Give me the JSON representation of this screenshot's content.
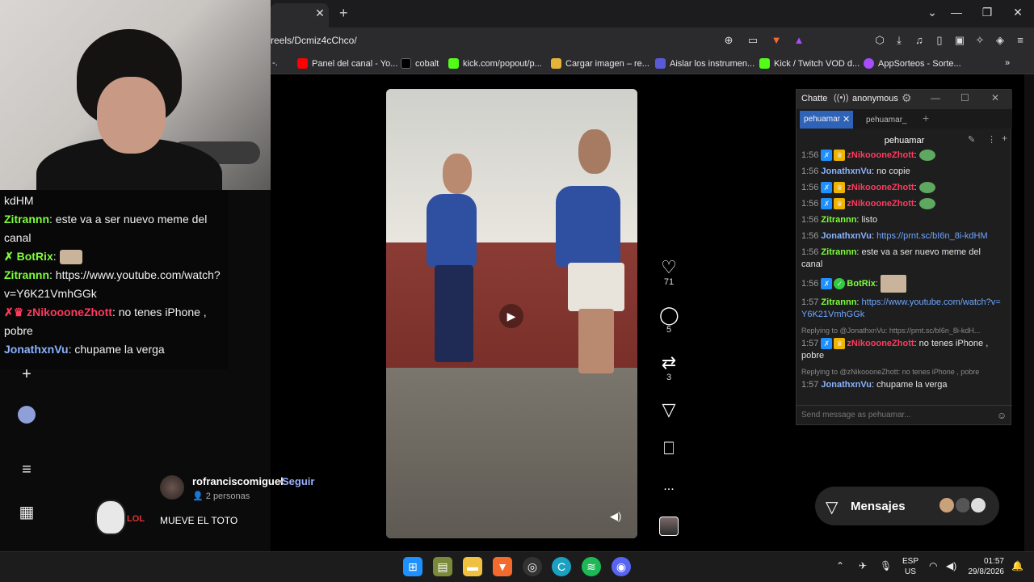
{
  "browser": {
    "tab_close": "✕",
    "new_tab": "+",
    "url": "reels/Dcmiz4cChco/",
    "bookmarks": [
      {
        "label": "-.",
        "color": ""
      },
      {
        "label": "Panel del canal - Yo...",
        "color": "#ff0000"
      },
      {
        "label": "cobalt",
        "color": "#222222"
      },
      {
        "label": "kick.com/popout/p...",
        "color": "#53fc18"
      },
      {
        "label": "Cargar imagen – re...",
        "color": "#e6b33a"
      },
      {
        "label": "Aislar los instrumen...",
        "color": "#5a5ad8"
      },
      {
        "label": "Kick / Twitch VOD d...",
        "color": "#53fc18"
      },
      {
        "label": "AppSorteos - Sorte...",
        "color": "#a64dff"
      }
    ],
    "more_bookmarks": "»",
    "window_controls": [
      "⌄",
      "—",
      "❐",
      "✕"
    ]
  },
  "left_chat": {
    "lines": [
      {
        "user": "",
        "text": "kdHM",
        "color": "#f0f0f0"
      },
      {
        "user": "Zitrannn",
        "text": ": este va a ser nuevo meme del canal",
        "color": "#7fff3a"
      },
      {
        "user": "✗ BotRix",
        "text": ":",
        "color": "#7fff3a"
      },
      {
        "user": "Zitrannn",
        "text": ": https://www.youtube.com/watch?v=Y6K21VmhGGk",
        "color": "#7fff3a"
      },
      {
        "user": "✗♛ zNikoooneZhott",
        "text": ": no tenes iPhone , pobre",
        "color": "#ff3a5e"
      },
      {
        "user": "JonathxnVu",
        "text": ": chupame la verga",
        "color": "#8ab4ff"
      }
    ]
  },
  "sidebar": {
    "icons": [
      "plus-icon",
      "avatar-icon",
      "menu-icon",
      "grid-icon"
    ]
  },
  "reel": {
    "likes": "71",
    "comments": "5",
    "reposts": "3",
    "more": "...",
    "author": "rofranciscomiguel",
    "follow_sep": "•",
    "follow": "Seguir",
    "persons": "2 personas",
    "caption": "MUEVE EL TOTO",
    "meme_text": "LOL"
  },
  "chatterino": {
    "title": "Chatte",
    "anon": "anonymous",
    "tabs": [
      "pehuamar",
      "pehuamar_"
    ],
    "add_tab": "+",
    "channel": "pehuamar",
    "messages": [
      {
        "time": "1:56",
        "user": "zNikoooneZhott",
        "text": "",
        "color": "#ff3a5e",
        "badges": true
      },
      {
        "time": "1:56",
        "user": "JonathxnVu",
        "text": "no copie",
        "color": "#8ab4ff"
      },
      {
        "time": "1:56",
        "user": "zNikoooneZhott",
        "text": "",
        "color": "#ff3a5e",
        "badges": true
      },
      {
        "time": "1:56",
        "user": "zNikoooneZhott",
        "text": "",
        "color": "#ff3a5e",
        "badges": true
      },
      {
        "time": "1:56",
        "user": "Zitrannn",
        "text": "listo",
        "color": "#7fff3a"
      },
      {
        "time": "1:56",
        "user": "JonathxnVu",
        "text": "https://prnt.sc/bI6n_8i-kdHM",
        "color": "#8ab4ff",
        "link": true
      },
      {
        "time": "1:56",
        "user": "Zitrannn",
        "text": "este va a ser nuevo meme del canal",
        "color": "#7fff3a"
      },
      {
        "time": "1:56",
        "user": "BotRix",
        "text": "",
        "color": "#7fff3a",
        "badges": true
      },
      {
        "time": "1:57",
        "user": "Zitrannn",
        "text": "https://www.youtube.com/watch?v=Y6K21VmhGGk",
        "color": "#7fff3a",
        "link": true
      },
      {
        "reply": "Replying to @JonathxnVu: https://prnt.sc/bI6n_8i-kdH...",
        "time": "1:57",
        "user": "zNikoooneZhott",
        "text": "no tenes iPhone , pobre",
        "color": "#ff3a5e",
        "badges": true
      },
      {
        "reply": "Replying to @zNikoooneZhott: no tenes iPhone , pobre",
        "time": "1:57",
        "user": "JonathxnVu",
        "text": "chupame la verga",
        "color": "#8ab4ff"
      }
    ],
    "input_placeholder": "Send message as pehuamar..."
  },
  "messages_button": {
    "label": "Mensajes"
  },
  "taskbar": {
    "lang": "ESP",
    "region": "US",
    "time": "01:57",
    "date": "29/8/2026"
  }
}
